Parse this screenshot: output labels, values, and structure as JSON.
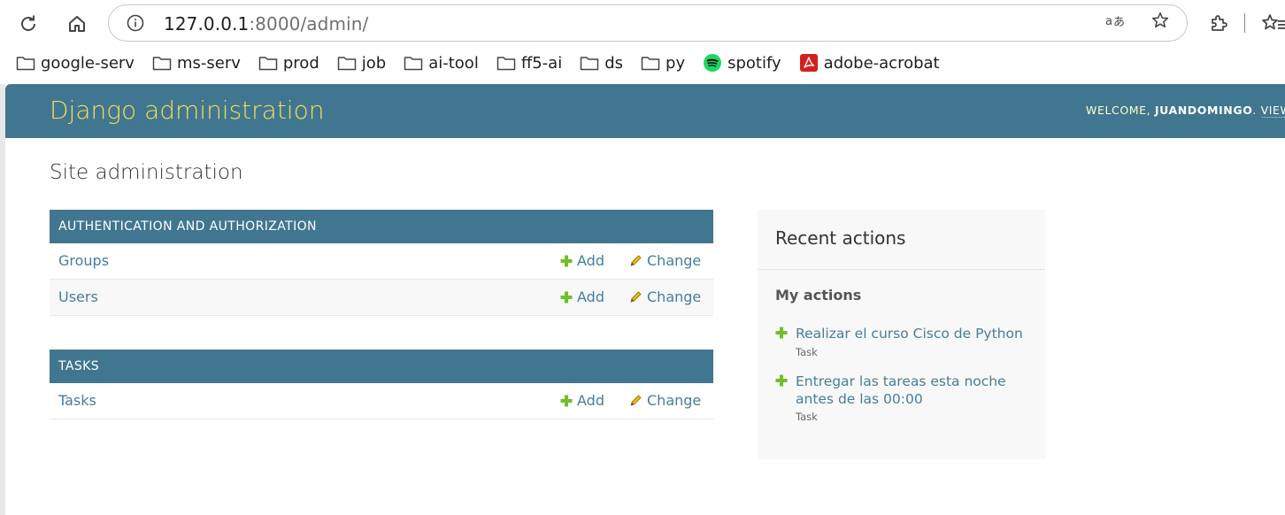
{
  "browser": {
    "url_host": "127.0.0.1",
    "url_rest": ":8000/admin/",
    "bookmarks": [
      {
        "label": "google-serv",
        "icon": "folder-icon"
      },
      {
        "label": "ms-serv",
        "icon": "folder-icon"
      },
      {
        "label": "prod",
        "icon": "folder-icon"
      },
      {
        "label": "job",
        "icon": "folder-icon"
      },
      {
        "label": "ai-tool",
        "icon": "folder-icon"
      },
      {
        "label": "ff5-ai",
        "icon": "folder-icon"
      },
      {
        "label": "ds",
        "icon": "folder-icon"
      },
      {
        "label": "py",
        "icon": "folder-icon"
      },
      {
        "label": "spotify",
        "icon": "spotify-icon"
      },
      {
        "label": "adobe-acrobat",
        "icon": "acrobat-icon"
      }
    ]
  },
  "header": {
    "brand": "Django administration",
    "welcome": "WELCOME, ",
    "username": "JUANDOMINGO",
    "after_user": ". ",
    "view_link": "VIEW"
  },
  "page": {
    "title": "Site administration"
  },
  "modules": {
    "auth": {
      "caption": "AUTHENTICATION AND AUTHORIZATION",
      "rows": [
        {
          "model": "Groups",
          "add": "Add",
          "change": "Change"
        },
        {
          "model": "Users",
          "add": "Add",
          "change": "Change"
        }
      ]
    },
    "tasks": {
      "caption": "TASKS",
      "rows": [
        {
          "model": "Tasks",
          "add": "Add",
          "change": "Change"
        }
      ]
    }
  },
  "recent": {
    "title": "Recent actions",
    "subtitle": "My actions",
    "actions": [
      {
        "text": "Realizar el curso Cisco de Python",
        "type": "Task"
      },
      {
        "text": "Entregar las tareas esta noche antes de las 00:00",
        "type": "Task"
      }
    ]
  },
  "colors": {
    "header_bg": "#417690",
    "brand": "#f5dd5d",
    "link": "#447e9b",
    "add_icon": "#70bf2b",
    "change_icon": "#efb80b"
  }
}
